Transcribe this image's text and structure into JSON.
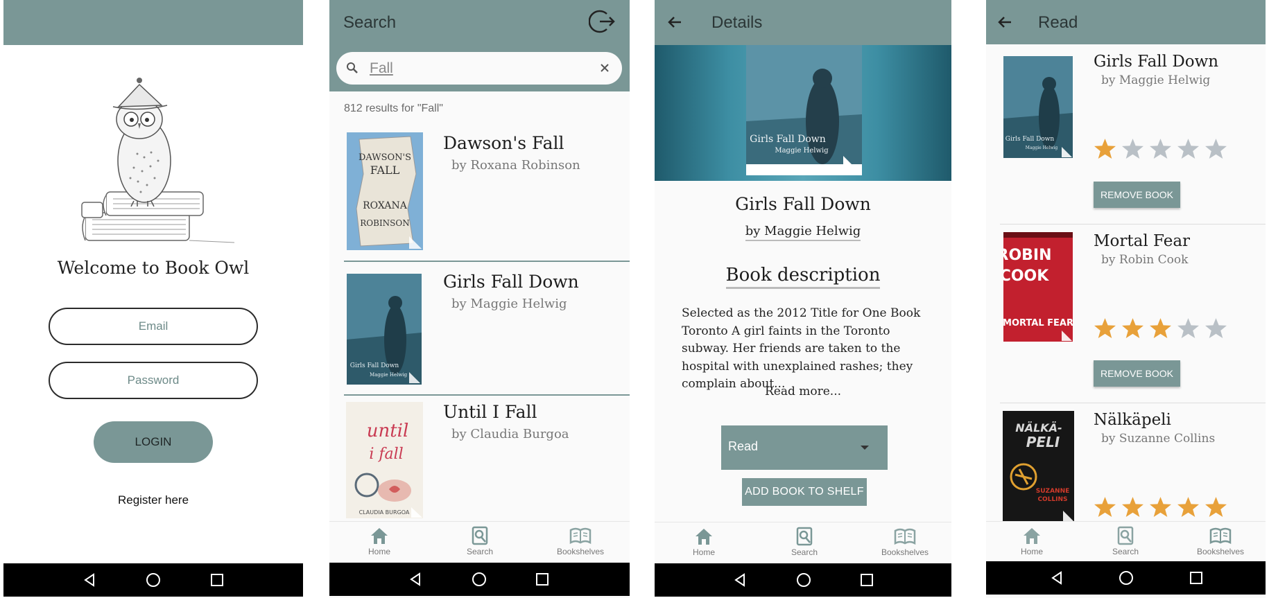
{
  "login": {
    "welcome": "Welcome to Book Owl",
    "email_placeholder": "Email",
    "password_placeholder": "Password",
    "login_label": "LOGIN",
    "register_label": "Register here"
  },
  "search": {
    "title": "Search",
    "query": "Fall",
    "results_count": "812 results for \"Fall\"",
    "results": [
      {
        "title": "Dawson's Fall",
        "author": "by Roxana Robinson"
      },
      {
        "title": "Girls Fall Down",
        "author": "by Maggie Helwig"
      },
      {
        "title": "Until I Fall",
        "author": "by Claudia Burgoa"
      }
    ]
  },
  "details": {
    "title": "Details",
    "book_title": "Girls Fall Down",
    "book_author": "by Maggie Helwig",
    "section_heading": "Book description",
    "description": "Selected as the 2012 Title for One Book Toronto A girl faints in the Toronto subway. Her friends are taken to the hospital with unexplained rashes; they complain about...",
    "read_more": "Read more...",
    "shelf_selected": "Read",
    "add_label": "ADD BOOK TO SHELF"
  },
  "read": {
    "title": "Read",
    "remove_label": "REMOVE BOOK",
    "books": [
      {
        "title": "Girls Fall Down",
        "author": "by Maggie Helwig",
        "rating": 1
      },
      {
        "title": "Mortal Fear",
        "author": "by Robin Cook",
        "rating": 3
      },
      {
        "title": "Nälkäpeli",
        "author": "by Suzanne Collins",
        "rating": 5
      }
    ]
  },
  "nav": {
    "home": "Home",
    "search": "Search",
    "bookshelves": "Bookshelves"
  },
  "covers": {
    "dawsons_fall": {
      "lines": [
        "DAWSON'S",
        "FALL",
        "ROXANA",
        "ROBINSON"
      ]
    },
    "girls_fall_down": {
      "lines": [
        "Girls Fall Down",
        "Maggie Helwig"
      ]
    },
    "until_i_fall": {
      "lines": [
        "until",
        "i fall",
        "CLAUDIA BURGOA"
      ]
    },
    "mortal_fear": {
      "lines": [
        "ROBIN",
        "COOK",
        "MORTAL FEAR"
      ]
    },
    "nalkapeli": {
      "lines": [
        "NÄLKÄ-",
        "PELI",
        "SUZANNE",
        "COLLINS"
      ]
    }
  },
  "colors": {
    "appbar": "#7a9796",
    "star_on": "#e8a13a",
    "star_off": "#b9c0c6"
  }
}
